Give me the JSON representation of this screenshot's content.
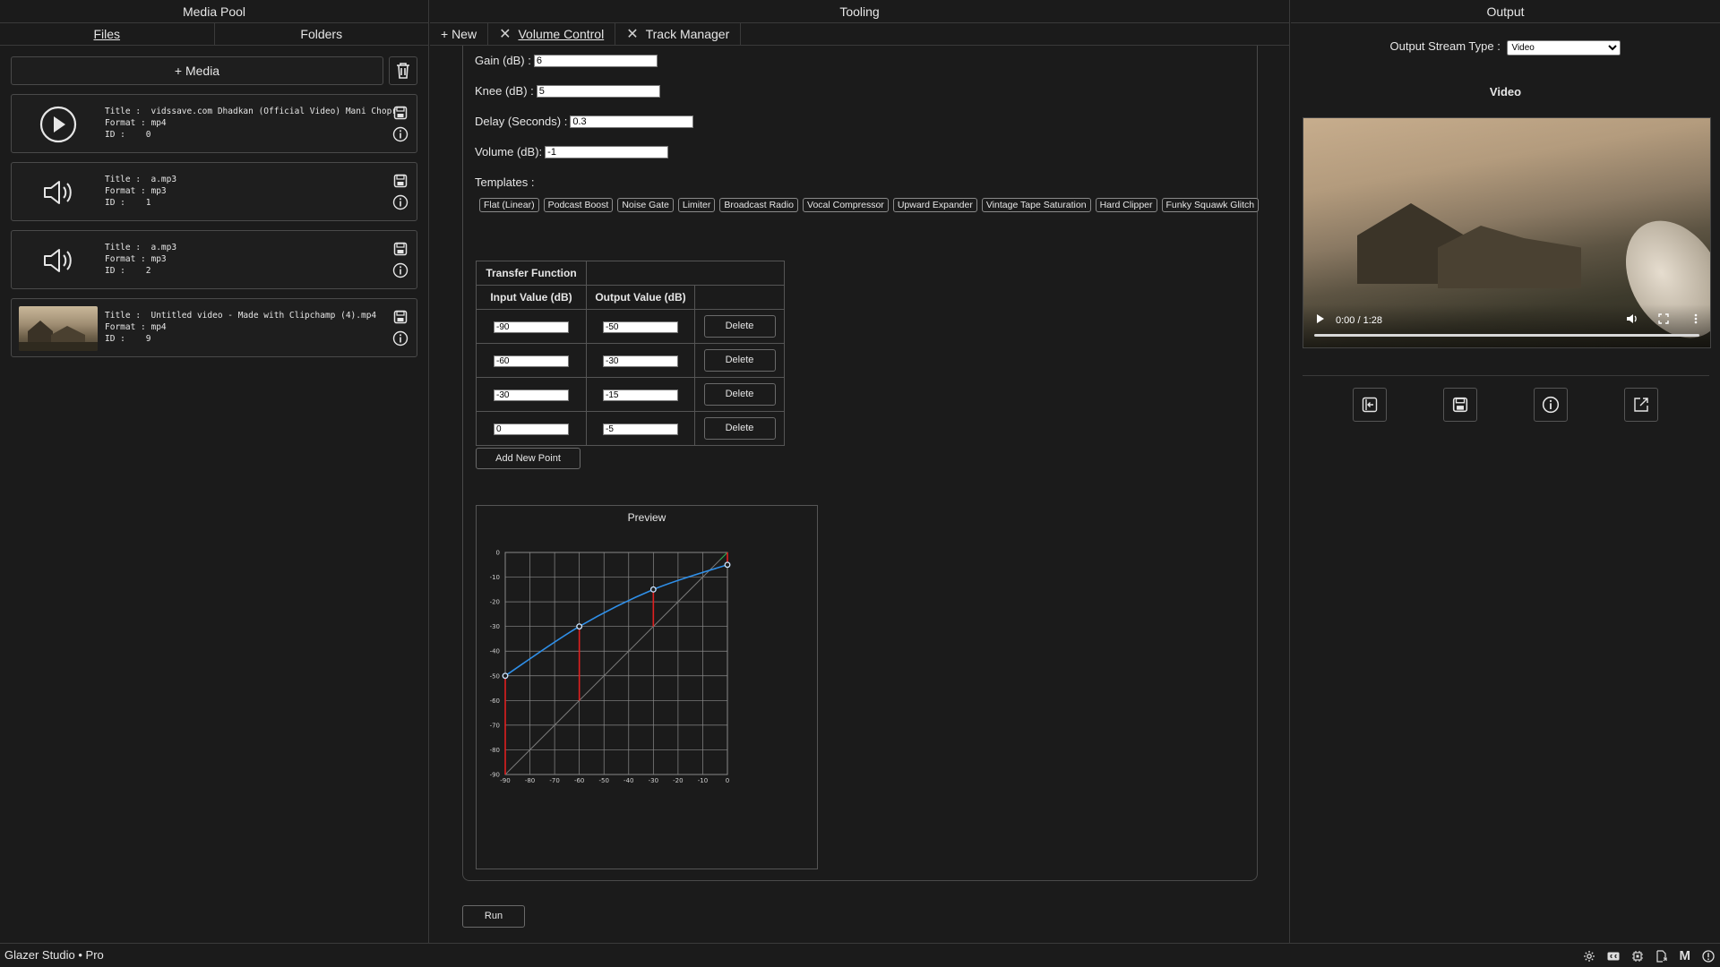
{
  "panes": {
    "left_title": "Media Pool",
    "mid_title": "Tooling",
    "right_title": "Output"
  },
  "media_pool": {
    "tabs": [
      "Files",
      "Folders"
    ],
    "add_media": "+ Media",
    "items": [
      {
        "kind": "video-icon",
        "title": "Title :  vidssave.com Dhadkan (Official Video) Mani Chopr",
        "format": "Format : mp4",
        "id": "ID :    0"
      },
      {
        "kind": "audio-icon",
        "title": "Title :  a.mp3",
        "format": "Format : mp3",
        "id": "ID :    1"
      },
      {
        "kind": "audio-icon",
        "title": "Title :  a.mp3",
        "format": "Format : mp3",
        "id": "ID :    2"
      },
      {
        "kind": "thumbnail",
        "title": "Title :  Untitled video - Made with Clipchamp (4).mp4",
        "format": "Format : mp4",
        "id": "ID :    9"
      }
    ]
  },
  "tooling": {
    "tabs": {
      "new": "+ New",
      "volume": "Volume Control",
      "track": "Track Manager"
    },
    "fields": {
      "gain_label": "Gain (dB) :",
      "gain_value": "6",
      "knee_label": "Knee (dB) :",
      "knee_value": "5",
      "delay_label": "Delay (Seconds) :",
      "delay_value": "0.3",
      "volume_label": "Volume (dB):",
      "volume_value": "-1"
    },
    "templates_label": "Templates :",
    "templates": [
      "Flat (Linear)",
      "Podcast Boost",
      "Noise Gate",
      "Limiter",
      "Broadcast Radio",
      "Vocal Compressor",
      "Upward Expander",
      "Vintage Tape Saturation",
      "Hard Clipper",
      "Funky Squawk Glitch"
    ],
    "table": {
      "title": "Transfer Function",
      "col_input": "Input Value (dB)",
      "col_output": "Output Value (dB)",
      "rows": [
        {
          "input": "-90",
          "output": "-50"
        },
        {
          "input": "-60",
          "output": "-30"
        },
        {
          "input": "-30",
          "output": "-15"
        },
        {
          "input": "0",
          "output": "-5"
        }
      ],
      "delete_label": "Delete"
    },
    "add_point": "Add New Point",
    "preview_title": "Preview",
    "run": "Run"
  },
  "chart_data": {
    "type": "line",
    "title": "Preview",
    "xlabel": "",
    "ylabel": "",
    "xlim": [
      -90,
      0
    ],
    "ylim": [
      -90,
      0
    ],
    "x_ticks": [
      "-90",
      "-80",
      "-70",
      "-60",
      "-50",
      "-40",
      "-30",
      "-20",
      "-10",
      "0"
    ],
    "y_ticks": [
      "0",
      "-10",
      "-20",
      "-30",
      "-40",
      "-50",
      "-60",
      "-70",
      "-80",
      "-90"
    ],
    "grid": true,
    "points": [
      {
        "x": -90,
        "y": -50
      },
      {
        "x": -60,
        "y": -30
      },
      {
        "x": -30,
        "y": -15
      },
      {
        "x": 0,
        "y": -5
      }
    ],
    "curve_color": "#2f8fe8",
    "identity_color": "#7a7a7a",
    "gain_color": "#e02020"
  },
  "output": {
    "stream_label": "Output Stream Type :",
    "stream_value": "Video",
    "video_title": "Video",
    "video_time": "0:00 / 1:28",
    "video_progress": 0
  },
  "status": {
    "app": "Glazer Studio • Pro"
  },
  "colors": {
    "bg": "#1b1b1b",
    "border": "#3a3a3a",
    "text": "#e6e6e6"
  }
}
